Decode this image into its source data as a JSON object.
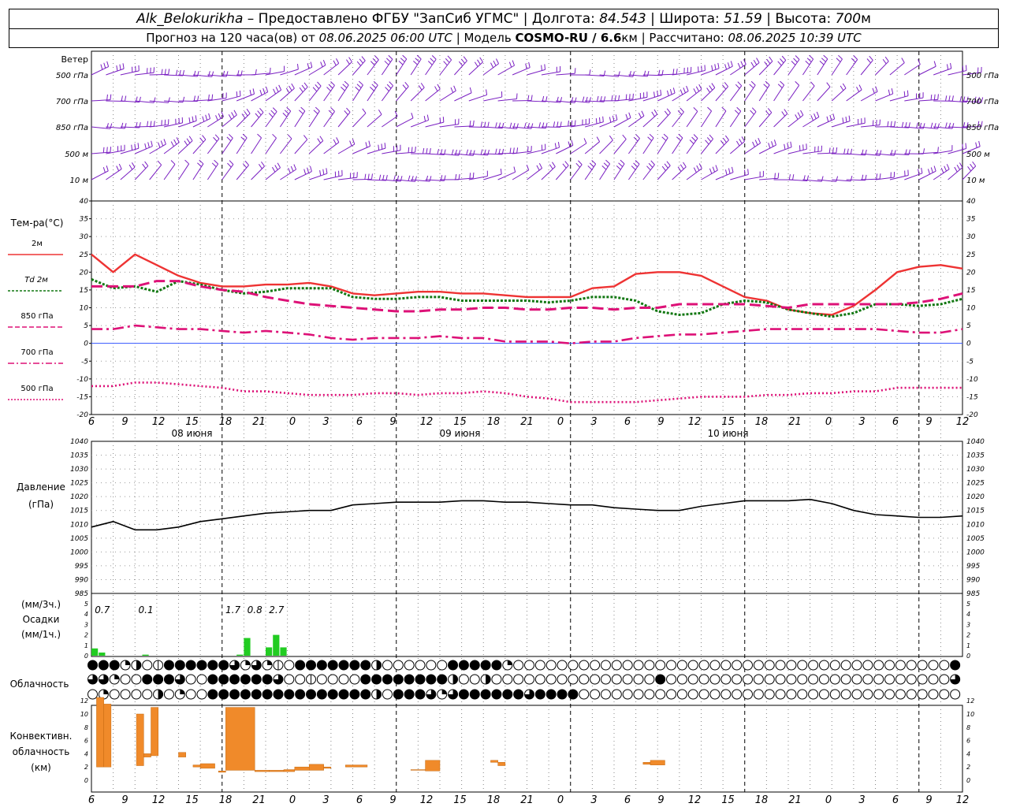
{
  "header": {
    "station": "Alk_Belokurikha",
    "provider": " – Предоставлено ФГБУ \"ЗапСиб УГМС\" | Долгота: ",
    "lon": "84.543",
    "lat_label": " | Широта: ",
    "lat": "51.59",
    "alt_label": " | Высота: ",
    "alt": "700",
    "alt_unit": "м",
    "forecast_prefix": "Прогноз на 120 часа(ов) от ",
    "forecast_time": "08.06.2025 06:00 UTC",
    "model_label": " | Модель ",
    "model": "COSMO-RU / 6.6",
    "model_unit": "км",
    "computed_label": " | Рассчитано: ",
    "computed_time": "08.06.2025 10:39 UTC"
  },
  "wind": {
    "title": "Ветер",
    "levels": [
      "500 гПа",
      "700 гПа",
      "850 гПа",
      "500 м",
      "10 м"
    ],
    "color": "#7a1fc2"
  },
  "time_axis": {
    "ticks": [
      "6",
      "9",
      "12",
      "15",
      "18",
      "21",
      "0",
      "3",
      "6",
      "9",
      "12",
      "15",
      "18",
      "21",
      "0",
      "3",
      "6",
      "9",
      "12",
      "15",
      "18",
      "21",
      "0",
      "3",
      "6",
      "9",
      "12"
    ],
    "days": [
      "08 июня",
      "09 июня",
      "10 июня"
    ]
  },
  "temperature_panel": {
    "title": "Тем-ра(°C)",
    "legend": [
      {
        "label": "2м",
        "color": "#ee3333"
      },
      {
        "label": "Td 2м",
        "color": "#117711"
      },
      {
        "label": "850 гПа",
        "color": "#dd1177"
      },
      {
        "label": "700 гПа",
        "color": "#dd1177"
      },
      {
        "label": "500 гПа",
        "color": "#dd1177"
      }
    ],
    "yticks": [
      "40",
      "35",
      "30",
      "25",
      "20",
      "15",
      "10",
      "5",
      "0",
      "-5",
      "-10",
      "-15",
      "-20"
    ]
  },
  "pressure_panel": {
    "title": "Давление",
    "unit": "(гПа)",
    "yticks": [
      "1040",
      "1035",
      "1030",
      "1025",
      "1020",
      "1015",
      "1010",
      "1005",
      "1000",
      "995",
      "990",
      "985"
    ]
  },
  "precip_panel": {
    "unit3": "(мм/3ч.)",
    "title": "Осадки",
    "unit1": "(мм/1ч.)",
    "yticks": [
      "5",
      "4",
      "3",
      "2",
      "1",
      "0"
    ],
    "totals": [
      {
        "text": "0.7",
        "hour": 1.5
      },
      {
        "text": "0.1",
        "hour": 7.5
      },
      {
        "text": "1.7",
        "hour": 19.5
      },
      {
        "text": "0.8",
        "hour": 22.5
      },
      {
        "text": "2.7",
        "hour": 25.5
      }
    ]
  },
  "cloud_panel": {
    "title": "Облачность",
    "rows": [
      "FFFQHOEFFFFFFTQTQEOFFFFFFFHOOOOOOFFFFFQOOOOOOOOOOOOOOOOOOOOOOOOOOOOOOOOOOOOOOOOF",
      "TTQOOFFFTOOFFFFFFTOOEOOOOFFFFFFFFHOOHOOOOOOOOOOOOOOOFOOOOOOOOOOOOOOOOOOOOOOOOOOT",
      "OQOOOOHOQOOFFFFFFFFFFFFFFFHOFFFTQTFFFFFFTFFFFOOOOOOOOOOOOOOOOOOOOOOOOOOOOOOOOOOO"
    ]
  },
  "convective_panel": {
    "title_lines": [
      "Конвективн.",
      "облачность",
      "(км)"
    ],
    "yticks": [
      "12",
      "10",
      "8",
      "6",
      "4",
      "2",
      "0"
    ],
    "color": "#f08a2a"
  },
  "chart_data": [
    {
      "type": "line",
      "title": "Тем-ра(°C)",
      "x_unit": "hours from 08.06.2025 06:00 UTC",
      "ylim": [
        -20,
        40
      ],
      "x": [
        0,
        3,
        6,
        9,
        12,
        15,
        18,
        21,
        24,
        27,
        30,
        33,
        36,
        39,
        42,
        45,
        48,
        51,
        54,
        57,
        60,
        63,
        66,
        69,
        72,
        75,
        78,
        81,
        84,
        87,
        90,
        93,
        96,
        99,
        102,
        105,
        108,
        111,
        114,
        117,
        120
      ],
      "series": [
        {
          "name": "2м",
          "values": [
            25,
            20,
            25,
            22,
            19,
            17,
            16,
            16,
            16.5,
            16.5,
            17,
            16,
            14,
            13.5,
            14,
            14.5,
            14.5,
            14,
            14,
            13.5,
            13,
            13,
            13,
            15.5,
            16,
            19.5,
            20,
            20,
            19,
            16,
            13,
            12,
            9.5,
            8.5,
            8,
            10.5,
            15,
            20,
            21.5,
            22,
            21
          ]
        },
        {
          "name": "Td 2м",
          "values": [
            18,
            15.5,
            16,
            14.5,
            17.5,
            16.5,
            15,
            14,
            14.5,
            15.5,
            15.5,
            15.5,
            13,
            12.5,
            12.5,
            13,
            13,
            12,
            12,
            12,
            12,
            11.5,
            12,
            13,
            13,
            12,
            9,
            8,
            8.5,
            11,
            12,
            11.5,
            9.5,
            8.5,
            7.5,
            8.5,
            11,
            11,
            10.5,
            11,
            12.5
          ]
        },
        {
          "name": "850 гПа",
          "values": [
            16,
            16,
            16,
            17.5,
            17.5,
            16,
            15,
            14.5,
            13,
            12,
            11,
            10.5,
            10,
            9.5,
            9,
            9,
            9.5,
            9.5,
            10,
            10,
            9.5,
            9.5,
            10,
            10,
            9.5,
            10,
            10,
            11,
            11,
            11,
            11,
            10.5,
            10,
            11,
            11,
            11,
            11,
            11,
            11.5,
            12.5,
            14
          ]
        },
        {
          "name": "700 гПа",
          "values": [
            4,
            4,
            5,
            4.5,
            4,
            4,
            3.5,
            3,
            3.5,
            3,
            2.5,
            1.5,
            1,
            1.5,
            1.5,
            1.5,
            2,
            1.5,
            1.5,
            0.5,
            0.5,
            0.5,
            0,
            0.5,
            0.5,
            1.5,
            2,
            2.5,
            2.5,
            3,
            3.5,
            4,
            4,
            4,
            4,
            4,
            4,
            3.5,
            3,
            3,
            4
          ]
        },
        {
          "name": "500 гПа",
          "values": [
            -12,
            -12,
            -11,
            -11,
            -11.5,
            -12,
            -12.5,
            -13.5,
            -13.5,
            -14,
            -14.5,
            -14.5,
            -14.5,
            -14,
            -14,
            -14.5,
            -14,
            -14,
            -13.5,
            -14,
            -15,
            -15.5,
            -16.5,
            -16.5,
            -16.5,
            -16.5,
            -16,
            -15.5,
            -15,
            -15,
            -15,
            -14.5,
            -14.5,
            -14,
            -14,
            -13.5,
            -13.5,
            -12.5,
            -12.5,
            -12.5,
            -12.5
          ]
        }
      ]
    },
    {
      "type": "line",
      "title": "Давление",
      "x_unit": "hours from 08.06.2025 06:00 UTC",
      "ylim": [
        985,
        1040
      ],
      "x": [
        0,
        3,
        6,
        9,
        12,
        15,
        18,
        21,
        24,
        27,
        30,
        33,
        36,
        39,
        42,
        45,
        48,
        51,
        54,
        57,
        60,
        63,
        66,
        69,
        72,
        75,
        78,
        81,
        84,
        87,
        90,
        93,
        96,
        99,
        102,
        105,
        108,
        111,
        114,
        117,
        120
      ],
      "series": [
        {
          "name": "Давление",
          "values": [
            1009,
            1011,
            1008,
            1008,
            1009,
            1011,
            1012,
            1013,
            1014,
            1014.5,
            1015,
            1015,
            1017,
            1017.5,
            1018,
            1018,
            1018,
            1018.5,
            1018.5,
            1018,
            1018,
            1017.5,
            1017,
            1017,
            1016,
            1015.5,
            1015,
            1015,
            1016.5,
            1017.5,
            1018.5,
            1018.5,
            1018.5,
            1019,
            1017.5,
            1015,
            1013.5,
            1013,
            1012.5,
            1012.5,
            1013
          ]
        }
      ]
    },
    {
      "type": "bar",
      "title": "Осадки",
      "ylim": [
        0,
        5
      ],
      "hours": [
        0,
        1,
        7,
        20,
        21,
        24,
        25,
        26
      ],
      "values": [
        0.7,
        0.3,
        0.1,
        0.1,
        1.7,
        0.8,
        2.0,
        0.8
      ]
    },
    {
      "type": "bar",
      "title": "Конвективн. облачность (км)",
      "ylim": [
        0,
        13
      ],
      "bars": [
        {
          "from": 0.7,
          "to": 1.7,
          "bottom": 2,
          "top": 12.5
        },
        {
          "from": 1.7,
          "to": 2.7,
          "bottom": 2,
          "top": 11.5
        },
        {
          "from": 6.2,
          "to": 7.2,
          "bottom": 2.2,
          "top": 10
        },
        {
          "from": 7.2,
          "to": 8.2,
          "bottom": 3.5,
          "top": 4
        },
        {
          "from": 8.2,
          "to": 9.2,
          "bottom": 3.7,
          "top": 11
        },
        {
          "from": 12,
          "to": 13,
          "bottom": 3.5,
          "top": 4.2
        },
        {
          "from": 14,
          "to": 15,
          "bottom": 2,
          "top": 2.3
        },
        {
          "from": 15,
          "to": 17,
          "bottom": 1.8,
          "top": 2.5
        },
        {
          "from": 17.5,
          "to": 18.5,
          "bottom": 1.2,
          "top": 1.4
        },
        {
          "from": 18.5,
          "to": 22.5,
          "bottom": 1.5,
          "top": 11
        },
        {
          "from": 22.5,
          "to": 24.5,
          "bottom": 1.3,
          "top": 1.5
        },
        {
          "from": 24.5,
          "to": 26.5,
          "bottom": 1.3,
          "top": 1.5
        },
        {
          "from": 26.5,
          "to": 28,
          "bottom": 1.3,
          "top": 1.6
        },
        {
          "from": 28,
          "to": 30,
          "bottom": 1.5,
          "top": 2
        },
        {
          "from": 30,
          "to": 32,
          "bottom": 1.5,
          "top": 2.4
        },
        {
          "from": 32,
          "to": 33,
          "bottom": 1.8,
          "top": 2
        },
        {
          "from": 35,
          "to": 38,
          "bottom": 2,
          "top": 2.3
        },
        {
          "from": 44,
          "to": 46,
          "bottom": 1.5,
          "top": 1.6
        },
        {
          "from": 46,
          "to": 48,
          "bottom": 1.4,
          "top": 3
        },
        {
          "from": 55,
          "to": 56,
          "bottom": 2.7,
          "top": 3
        },
        {
          "from": 56,
          "to": 57,
          "bottom": 2.2,
          "top": 2.7
        },
        {
          "from": 76,
          "to": 77,
          "bottom": 2.4,
          "top": 2.7
        },
        {
          "from": 77,
          "to": 79,
          "bottom": 2.3,
          "top": 3
        }
      ]
    }
  ]
}
